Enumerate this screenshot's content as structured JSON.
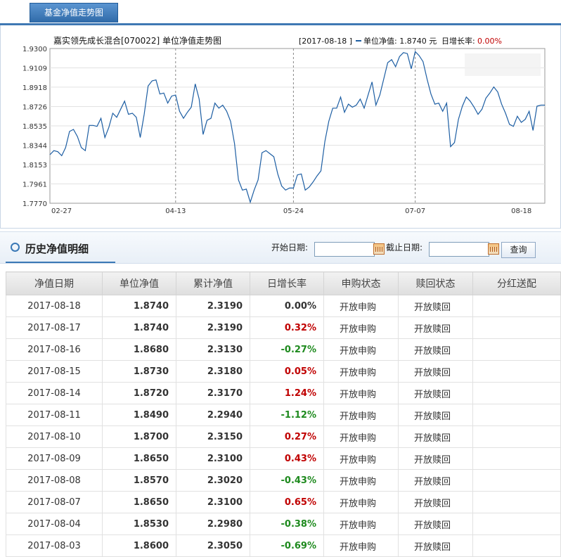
{
  "top_tab": {
    "label": "基金净值走势图"
  },
  "chart_data": {
    "type": "line",
    "title": "嘉实领先成长混合[070022] 单位净值走势图",
    "info": {
      "date": "[2017-08-18 ]",
      "nav_label": "单位净值: 1.8740 元",
      "change_label": "日增长率:",
      "change_value": "0.00%"
    },
    "y_ticks": [
      "1.9300",
      "1.9109",
      "1.8918",
      "1.8726",
      "1.8535",
      "1.8344",
      "1.8153",
      "1.7961",
      "1.7770"
    ],
    "ylim": [
      1.777,
      1.93
    ],
    "x_ticks": [
      "02-27",
      "04-13",
      "05-24",
      "07-07",
      "08-18"
    ],
    "x_tick_index": [
      0,
      32,
      62,
      93,
      123
    ],
    "series": [
      {
        "values": [
          1.825,
          1.829,
          1.828,
          1.824,
          1.832,
          1.848,
          1.85,
          1.843,
          1.832,
          1.829,
          1.854,
          1.854,
          1.853,
          1.861,
          1.842,
          1.852,
          1.866,
          1.862,
          1.87,
          1.878,
          1.865,
          1.866,
          1.862,
          1.842,
          1.865,
          1.893,
          1.898,
          1.899,
          1.885,
          1.886,
          1.876,
          1.883,
          1.884,
          1.868,
          1.861,
          1.867,
          1.872,
          1.895,
          1.88,
          1.845,
          1.859,
          1.861,
          1.876,
          1.871,
          1.874,
          1.868,
          1.858,
          1.836,
          1.8,
          1.79,
          1.791,
          1.778,
          1.79,
          1.8,
          1.827,
          1.829,
          1.826,
          1.823,
          1.806,
          1.794,
          1.79,
          1.792,
          1.792,
          1.805,
          1.806,
          1.79,
          1.793,
          1.798,
          1.804,
          1.809,
          1.838,
          1.858,
          1.871,
          1.871,
          1.882,
          1.867,
          1.875,
          1.872,
          1.874,
          1.88,
          1.871,
          1.884,
          1.897,
          1.874,
          1.884,
          1.9,
          1.916,
          1.919,
          1.912,
          1.922,
          1.926,
          1.925,
          1.91,
          1.927,
          1.923,
          1.917,
          1.9,
          1.885,
          1.875,
          1.876,
          1.868,
          1.876,
          1.833,
          1.837,
          1.86,
          1.873,
          1.882,
          1.878,
          1.872,
          1.865,
          1.87,
          1.881,
          1.886,
          1.892,
          1.887,
          1.875,
          1.866,
          1.855,
          1.853,
          1.863,
          1.857,
          1.86,
          1.868,
          1.849,
          1.873,
          1.874,
          1.874
        ]
      }
    ]
  },
  "section": {
    "title": "历史净值明细"
  },
  "filter": {
    "start_label": "开始日期:",
    "end_label": "截止日期:",
    "start_value": "",
    "end_value": "",
    "query_label": "查询"
  },
  "table": {
    "headers": [
      "净值日期",
      "单位净值",
      "累计净值",
      "日增长率",
      "申购状态",
      "赎回状态",
      "分红送配"
    ],
    "rows": [
      [
        "2017-08-18",
        "1.8740",
        "2.3190",
        "0.00%",
        "开放申购",
        "开放赎回",
        ""
      ],
      [
        "2017-08-17",
        "1.8740",
        "2.3190",
        "0.32%",
        "开放申购",
        "开放赎回",
        ""
      ],
      [
        "2017-08-16",
        "1.8680",
        "2.3130",
        "-0.27%",
        "开放申购",
        "开放赎回",
        ""
      ],
      [
        "2017-08-15",
        "1.8730",
        "2.3180",
        "0.05%",
        "开放申购",
        "开放赎回",
        ""
      ],
      [
        "2017-08-14",
        "1.8720",
        "2.3170",
        "1.24%",
        "开放申购",
        "开放赎回",
        ""
      ],
      [
        "2017-08-11",
        "1.8490",
        "2.2940",
        "-1.12%",
        "开放申购",
        "开放赎回",
        ""
      ],
      [
        "2017-08-10",
        "1.8700",
        "2.3150",
        "0.27%",
        "开放申购",
        "开放赎回",
        ""
      ],
      [
        "2017-08-09",
        "1.8650",
        "2.3100",
        "0.43%",
        "开放申购",
        "开放赎回",
        ""
      ],
      [
        "2017-08-08",
        "1.8570",
        "2.3020",
        "-0.43%",
        "开放申购",
        "开放赎回",
        ""
      ],
      [
        "2017-08-07",
        "1.8650",
        "2.3100",
        "0.65%",
        "开放申购",
        "开放赎回",
        ""
      ],
      [
        "2017-08-04",
        "1.8530",
        "2.2980",
        "-0.38%",
        "开放申购",
        "开放赎回",
        ""
      ],
      [
        "2017-08-03",
        "1.8600",
        "2.3050",
        "-0.69%",
        "开放申购",
        "开放赎回",
        ""
      ]
    ]
  }
}
